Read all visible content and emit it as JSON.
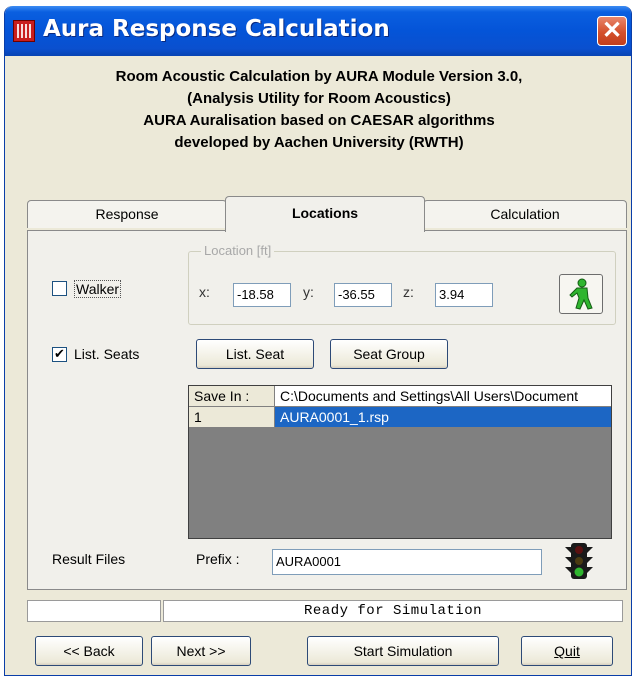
{
  "window": {
    "title": "Aura Response Calculation",
    "close_label": "✕"
  },
  "header": {
    "lines": [
      "Room Acoustic Calculation by AURA Module Version 3.0,",
      "(Analysis Utility for Room Acoustics)",
      "AURA Auralisation based on CAESAR algorithms",
      "developed by Aachen University (RWTH)"
    ]
  },
  "tabs": [
    {
      "label": "Response",
      "active": false
    },
    {
      "label": "Locations",
      "active": true
    },
    {
      "label": "Calculation",
      "active": false
    }
  ],
  "locations": {
    "walker": {
      "label": "Walker",
      "checked": false
    },
    "location_group": {
      "legend": "Location [ft]",
      "x_label": "x:",
      "x_value": "-18.58",
      "y_label": "y:",
      "y_value": "-36.55",
      "z_label": "z:",
      "z_value": "3.94",
      "walker_icon": "walking-man-icon"
    },
    "list_seats": {
      "label": "List. Seats",
      "checked": true
    },
    "list_seat_button": "List. Seat",
    "seat_group_button": "Seat Group",
    "files_grid": {
      "rows": [
        [
          "Save In :",
          "C:\\Documents and Settings\\All Users\\Document"
        ],
        [
          "1",
          "AURA0001_1.rsp"
        ]
      ],
      "selected_row": 1
    },
    "result_files_label": "Result Files",
    "prefix_label": "Prefix :",
    "prefix_value": "AURA0001",
    "traffic_light_icon": "traffic-light-icon",
    "colors": {
      "selection": "#1c66c4",
      "icon_green": "#2fb52f"
    }
  },
  "status": {
    "left": "",
    "message": "Ready for Simulation"
  },
  "buttons": {
    "back": "<< Back",
    "next": "Next >>",
    "start": "Start Simulation",
    "quit": "Quit"
  }
}
